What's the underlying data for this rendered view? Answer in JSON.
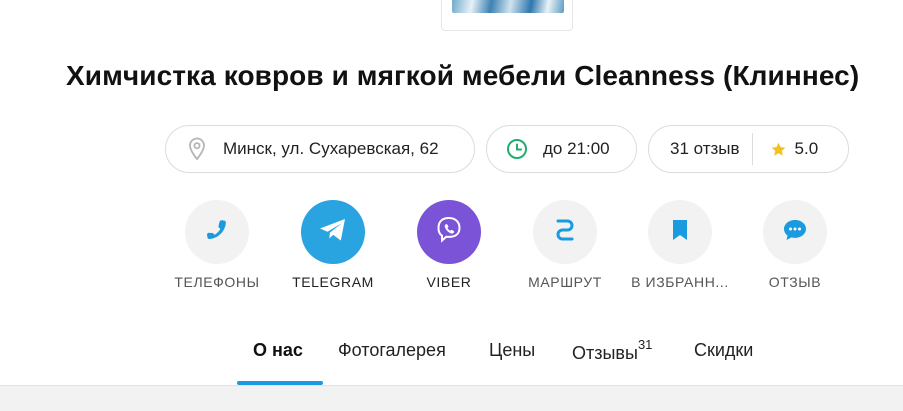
{
  "header": {
    "title": "Химчистка ковров и мягкой мебели Cleanness (Клиннес)"
  },
  "info": {
    "address": "Минск, ул. Сухаревская, 62",
    "hours": "до 21:00",
    "reviews_count": "31 отзыв",
    "rating": "5.0"
  },
  "actions": {
    "phone": "ТЕЛЕФОНЫ",
    "telegram": "TELEGRAM",
    "viber": "VIBER",
    "route": "МАРШРУТ",
    "favorites": "В ИЗБРАНН...",
    "review": "ОТЗЫВ"
  },
  "tabs": {
    "about": "О нас",
    "gallery": "Фотогалерея",
    "prices": "Цены",
    "reviews": "Отзывы",
    "reviews_badge": "31",
    "discounts": "Скидки"
  },
  "colors": {
    "accent": "#1a9be0",
    "telegram": "#2aa4e0",
    "viber": "#7a53d6",
    "clock": "#1fae6e",
    "star": "#f2c21b"
  }
}
